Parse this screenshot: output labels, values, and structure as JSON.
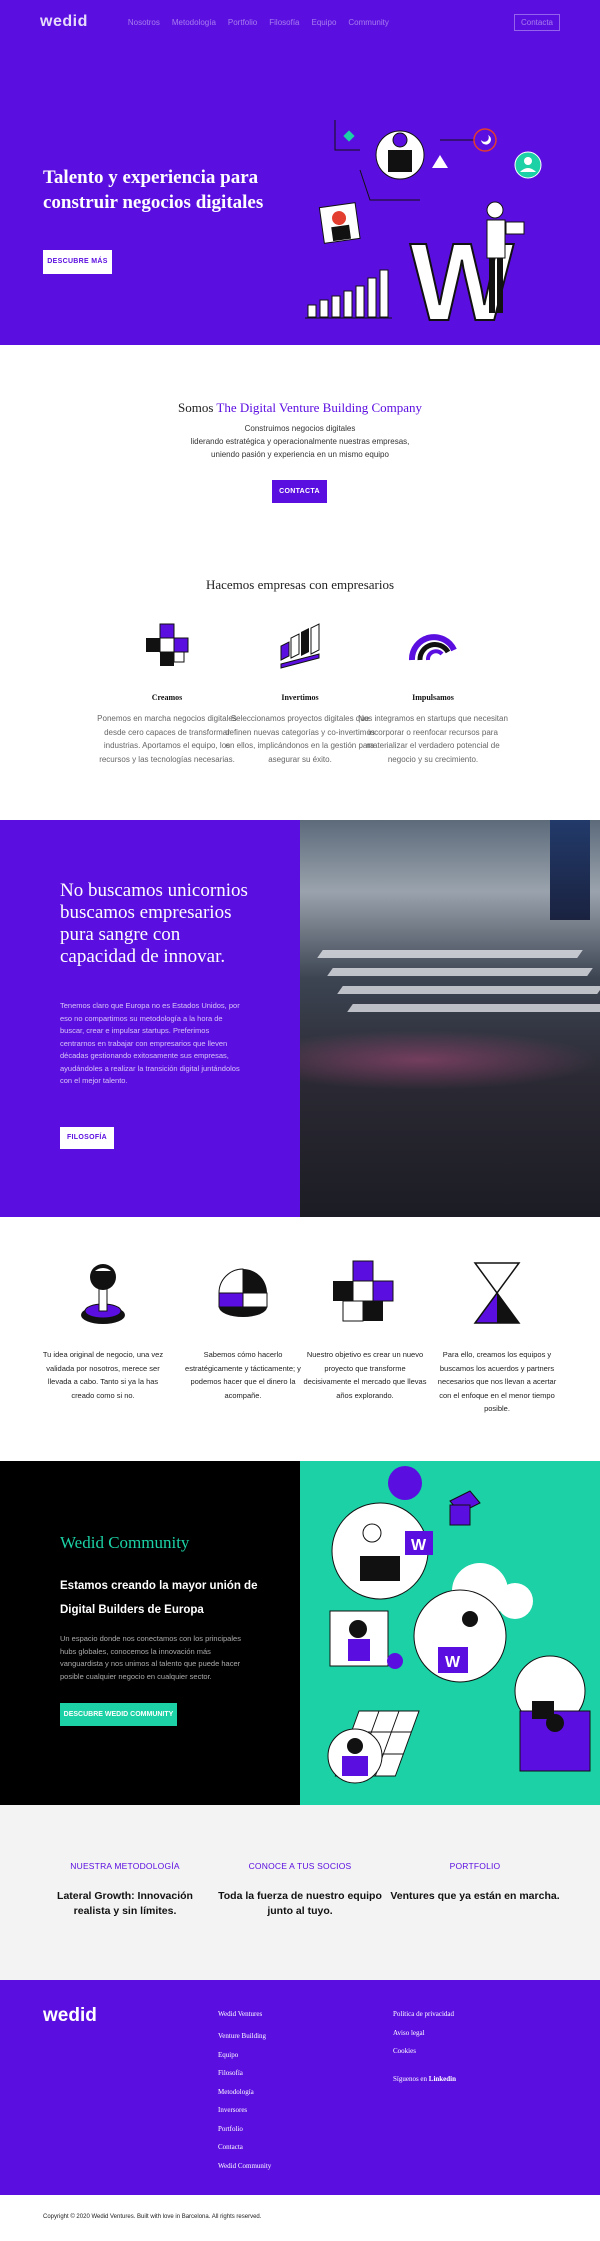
{
  "header": {
    "logo": "wedid",
    "nav": [
      "Nosotros",
      "Metodología",
      "Portfolio",
      "Filosofía",
      "Equipo",
      "Community"
    ],
    "cta": "Contacta"
  },
  "hero": {
    "title": "Talento y experiencia para construir negocios digitales",
    "button": "DESCUBRE MÁS",
    "logo_letter": "W"
  },
  "intro": {
    "title_prefix": "Somos ",
    "title_accent": "The Digital Venture Building Company",
    "lines": [
      "Construimos negocios digitales",
      "liderando estratégica y operacionalmente nuestras empresas,",
      "uniendo pasión y experiencia en un mismo equipo"
    ],
    "button": "CONTACTA"
  },
  "companies": {
    "title": "Hacemos empresas con empresarios",
    "columns": [
      {
        "title": "Creamos",
        "text": "Ponemos en marcha negocios digitales desde cero capaces de transformar industrias. Aportamos el equipo, los recursos y las tecnologías necesarias.",
        "icon": "cubes-icon"
      },
      {
        "title": "Invertimos",
        "text": "Seleccionamos proyectos digitales que definen nuevas categorías y co-invertimos en ellos, implicándonos en la gestión para asegurar su éxito.",
        "icon": "chart-blocks-icon"
      },
      {
        "title": "Impulsamos",
        "text": "Nos integramos en startups que necesitan incorporar o reenfocar recursos para materializar el verdadero potencial de negocio y su crecimiento.",
        "icon": "arcs-icon"
      }
    ]
  },
  "unicorn": {
    "title": "No buscamos unicornios buscamos empresarios pura sangre con capacidad de innovar.",
    "text": "Tenemos claro que Europa no es Estados Unidos, por eso no compartimos su metodología a la hora de buscar, crear e impulsar startups. Preferimos centrarnos en trabajar con empresarios que lleven décadas gestionando exitosamente sus empresas, ayudándoles a realizar la transición digital juntándolos con el mejor talento.",
    "button": "FILOSOFÍA"
  },
  "features": [
    {
      "text": "Tu idea original de negocio, una vez validada por nosotros, merece ser llevada a cabo. Tanto si ya la has creado como si no.",
      "icon": "joystick-icon"
    },
    {
      "text": "Sabemos cómo hacerlo estratégicamente y tácticamente; y podemos hacer que el dinero la acompañe.",
      "icon": "pie-chart-icon"
    },
    {
      "text": "Nuestro objetivo es crear un nuevo proyecto que transforme decisivamente el mercado que llevas años explorando.",
      "icon": "cubes-icon"
    },
    {
      "text": "Para ello, creamos los equipos y buscamos los acuerdos y partners necesarios que nos llevan a acertar con el enfoque en el menor tiempo posible.",
      "icon": "hourglass-icon"
    }
  ],
  "community": {
    "title": "Wedid Community",
    "subtitle": "Estamos creando la mayor unión de Digital Builders de Europa",
    "text": "Un espacio donde nos conectamos con los principales hubs globales, conocemos la innovación más vanguardista y nos unimos al talento que puede hacer posible cualquier negocio en cualquier sector.",
    "button": "DESCUBRE WEDID COMMUNITY"
  },
  "links": [
    {
      "heading": "NUESTRA METODOLOGÍA",
      "body": "Lateral Growth: Innovación realista y sin límites."
    },
    {
      "heading": "CONOCE A TUS SOCIOS",
      "body": "Toda la fuerza de nuestro equipo junto al tuyo."
    },
    {
      "heading": "PORTFOLIO",
      "body": "Ventures que ya están en marcha."
    }
  ],
  "footer": {
    "logo": "wedid",
    "col1": [
      "Wedid Ventures",
      "Venture Building",
      "Equipo",
      "Filosofía",
      "Metodología",
      "Inversores",
      "Portfolio",
      "Contacta",
      "Wedid Community"
    ],
    "col2": [
      "Política de privacidad",
      "Aviso legal",
      "Cookies"
    ],
    "follow_prefix": "Síguenos en ",
    "follow_network": "Linkedin"
  },
  "copyright": "Copyright © 2020 Wedid Ventures. Built with love in Barcelona. All rights reserved.",
  "colors": {
    "brand": "#5b0ee0",
    "teal": "#1bd1a5",
    "dark": "#000000"
  }
}
